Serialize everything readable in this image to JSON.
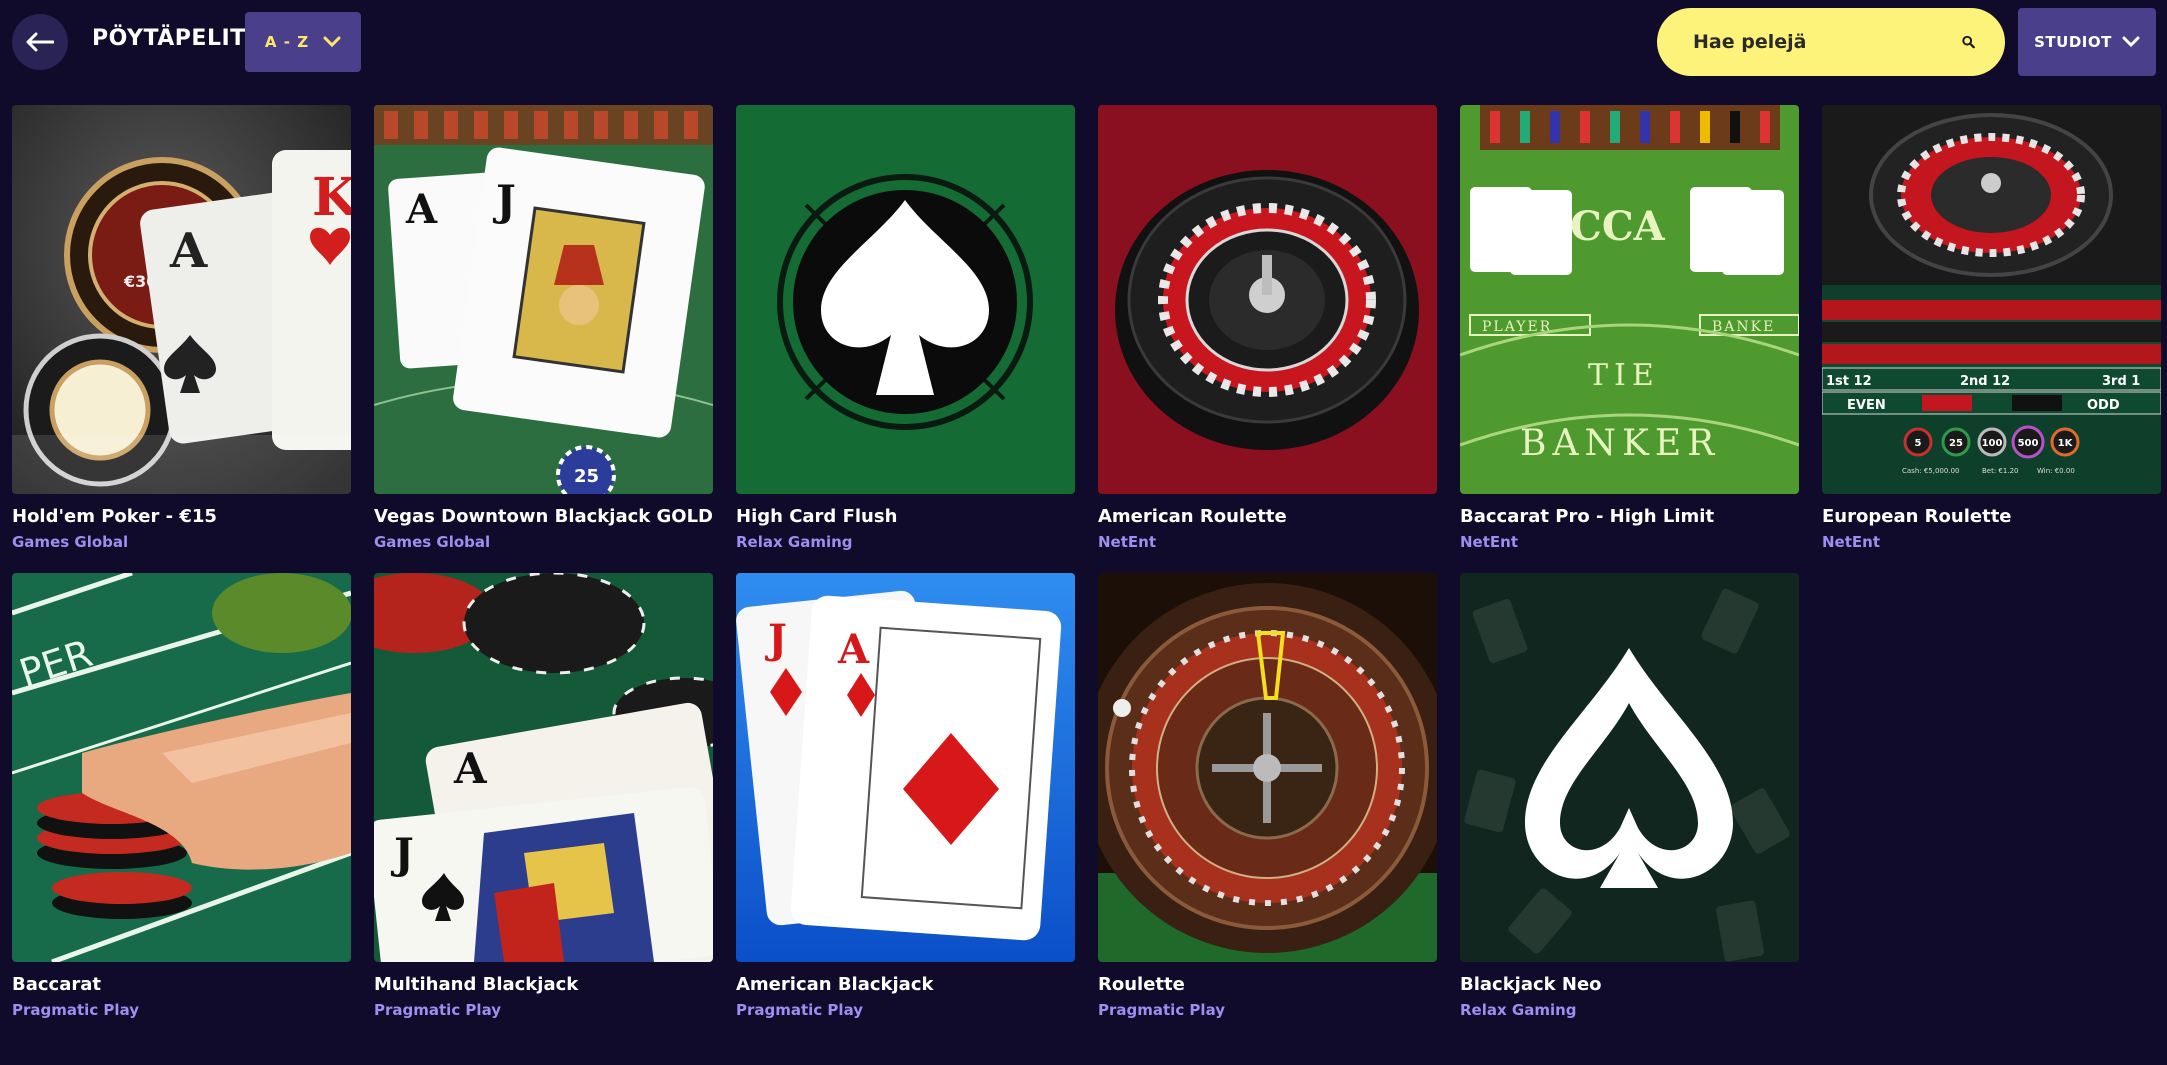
{
  "header": {
    "title": "PÖYTÄPELIT",
    "sort_label": "A - Z",
    "search_placeholder": "Hae pelejä",
    "studios_label": "STUDIOT"
  },
  "games": [
    {
      "title": "Hold'em Poker - €15",
      "studio": "Games Global"
    },
    {
      "title": "Vegas Downtown Blackjack GOLD",
      "studio": "Games Global"
    },
    {
      "title": "High Card Flush",
      "studio": "Relax Gaming"
    },
    {
      "title": "American Roulette",
      "studio": "NetEnt"
    },
    {
      "title": "Baccarat Pro - High Limit",
      "studio": "NetEnt"
    },
    {
      "title": "European Roulette",
      "studio": "NetEnt"
    },
    {
      "title": "Baccarat",
      "studio": "Pragmatic Play"
    },
    {
      "title": "Multihand Blackjack",
      "studio": "Pragmatic Play"
    },
    {
      "title": "American Blackjack",
      "studio": "Pragmatic Play"
    },
    {
      "title": "Roulette",
      "studio": "Pragmatic Play"
    },
    {
      "title": "Blackjack Neo",
      "studio": "Relax Gaming"
    }
  ],
  "thumb_text": {
    "holdem_k": "K",
    "holdem_a": "A",
    "holdem_chip": "€30",
    "vegas_a": "A",
    "vegas_j": "J",
    "vegas_chip": "25",
    "bacc_pro_banner": "CCA",
    "bacc_pro_player": "PLAYER",
    "bacc_pro_banker_tag": "BANKE",
    "bacc_pro_tie": "TIE",
    "bacc_pro_banker": "BANKER",
    "euro_even": "EVEN",
    "euro_odd": "ODD",
    "euro_12": "1st 12",
    "euro_2nd": "2nd 12",
    "euro_3rd": "3rd 1",
    "euro_chips": [
      "5",
      "25",
      "100",
      "500",
      "1K"
    ],
    "euro_cash": "Cash: €5,000.00",
    "euro_bet": "Bet: €1.20",
    "euro_win": "Win: €0.00",
    "bacc_table": "PER",
    "multi_a": "A",
    "multi_j": "J",
    "amer_j": "J",
    "amer_a": "A"
  },
  "colors": {
    "background": "#100b2a",
    "accent_button": "#4a3f8a",
    "search_bg": "#fdf27a",
    "sort_text": "#ffe56c",
    "studio_text": "#9d8ef0"
  }
}
